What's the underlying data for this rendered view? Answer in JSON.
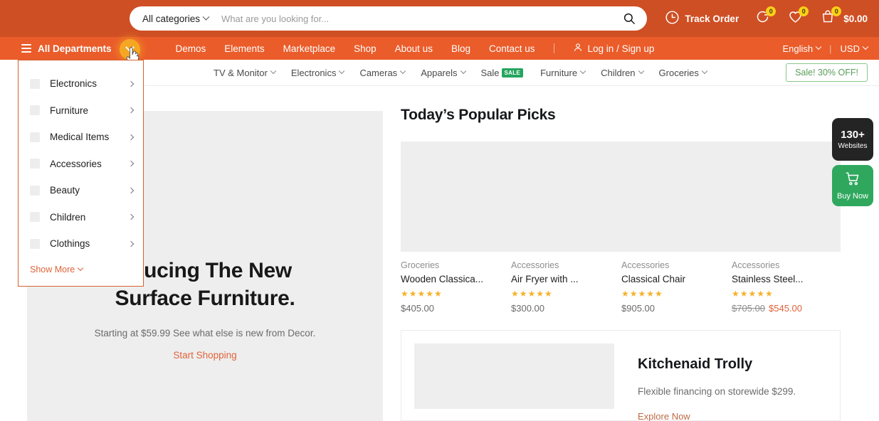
{
  "header": {
    "search": {
      "category_label": "All categories",
      "placeholder": "What are you looking for...",
      "value": "",
      "search_icon": "search-icon"
    },
    "track_order_label": "Track Order",
    "compare_badge": "0",
    "wishlist_badge": "0",
    "cart_badge": "0",
    "cart_total": "$0.00"
  },
  "nav": {
    "all_departments_label": "All Departments",
    "links": [
      {
        "label": "Demos"
      },
      {
        "label": "Elements"
      },
      {
        "label": "Marketplace"
      },
      {
        "label": "Shop"
      },
      {
        "label": "About us"
      },
      {
        "label": "Blog"
      },
      {
        "label": "Contact us"
      }
    ],
    "login_label": "Log in / Sign up",
    "language": "English",
    "currency": "USD"
  },
  "subnav": {
    "items": [
      {
        "label": "TV & Monitor",
        "caret": true,
        "badge": ""
      },
      {
        "label": "Electronics",
        "caret": true,
        "badge": ""
      },
      {
        "label": "Cameras",
        "caret": true,
        "badge": ""
      },
      {
        "label": "Apparels",
        "caret": true,
        "badge": ""
      },
      {
        "label": "Sale",
        "caret": false,
        "badge": "SALE"
      },
      {
        "label": "Furniture",
        "caret": true,
        "badge": ""
      },
      {
        "label": "Children",
        "caret": true,
        "badge": ""
      },
      {
        "label": "Groceries",
        "caret": true,
        "badge": ""
      }
    ],
    "sale_button": "Sale! 30% OFF!"
  },
  "departments_panel": {
    "items": [
      {
        "label": "Electronics"
      },
      {
        "label": "Furniture"
      },
      {
        "label": "Medical Items"
      },
      {
        "label": "Accessories"
      },
      {
        "label": "Beauty"
      },
      {
        "label": "Children"
      },
      {
        "label": "Clothings"
      }
    ],
    "show_more_label": "Show More"
  },
  "hero": {
    "title_line1": "oducing The New",
    "title_line2": "Surface Furniture.",
    "subtitle": "Starting at $59.99 See what else is new from Decor.",
    "cta": "Start Shopping"
  },
  "picks": {
    "title": "Today’s Popular Picks",
    "products": [
      {
        "category": "Groceries",
        "name": "Wooden Classica...",
        "rating": "★★★★★",
        "price": "$405.00",
        "old_price": "",
        "new_price": ""
      },
      {
        "category": "Accessories",
        "name": "Air Fryer with ...",
        "rating": "★★★★★",
        "price": "$300.00",
        "old_price": "",
        "new_price": ""
      },
      {
        "category": "Accessories",
        "name": "Classical Chair",
        "rating": "★★★★★",
        "price": "$905.00",
        "old_price": "",
        "new_price": ""
      },
      {
        "category": "Accessories",
        "name": "Stainless Steel...",
        "rating": "★★★★★",
        "price": "",
        "old_price": "$705.00",
        "new_price": "$545.00"
      }
    ]
  },
  "promo": {
    "title": "Kitchenaid Trolly",
    "description": "Flexible financing on storewide $299.",
    "cta": "Explore Now"
  },
  "floating": {
    "websites_count": "130+",
    "websites_label": "Websites",
    "buy_now_label": "Buy Now"
  },
  "colors": {
    "topbar": "#cf4f24",
    "navbar": "#ea5c2a",
    "accent_orange": "#e0633a",
    "badge_yellow": "#fdd017",
    "sale_green": "#25a55f",
    "buy_green": "#2fa85e",
    "toggle_amber": "#f5a623",
    "star_gold": "#f5b228"
  }
}
